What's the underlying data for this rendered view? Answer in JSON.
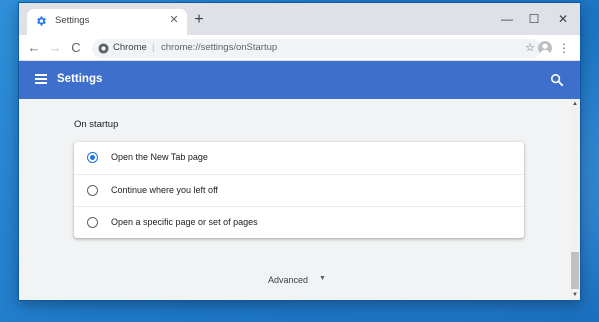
{
  "tab": {
    "title": "Settings",
    "close": "✕",
    "new_tab": "+"
  },
  "window_controls": {
    "minimize": "—",
    "maximize": "☐",
    "close": "✕"
  },
  "toolbar": {
    "back": "←",
    "forward": "→",
    "reload": "C",
    "chip": "Chrome",
    "separator": "|",
    "url": "chrome://settings/onStartup",
    "star": "☆",
    "menu": "⋮"
  },
  "header": {
    "title": "Settings"
  },
  "startup": {
    "section_title": "On startup",
    "options": [
      {
        "label": "Open the New Tab page",
        "selected": true
      },
      {
        "label": "Continue where you left off",
        "selected": false
      },
      {
        "label": "Open a specific page or set of pages",
        "selected": false
      }
    ]
  },
  "advanced": {
    "label": "Advanced",
    "caret": "▼"
  },
  "scrollbar": {
    "up": "▲",
    "down": "▼"
  },
  "colors": {
    "header": "#3f6fcd",
    "accent": "#1a73e8",
    "desktop": "#1f78c8"
  },
  "icons": [
    "settings-gear-icon",
    "search-icon",
    "hamburger-icon",
    "star-icon",
    "profile-icon"
  ]
}
